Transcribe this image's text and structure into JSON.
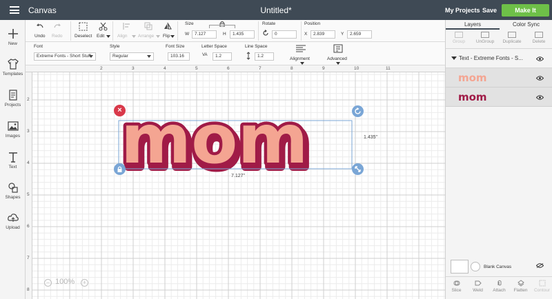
{
  "topbar": {
    "app_title": "Canvas",
    "doc_title": "Untitled*",
    "my_projects": "My Projects",
    "save": "Save",
    "make_it": "Make It"
  },
  "sidebar": {
    "items": [
      {
        "label": "New",
        "icon": "plus-icon"
      },
      {
        "label": "Templates",
        "icon": "shirt-icon"
      },
      {
        "label": "Projects",
        "icon": "projects-icon"
      },
      {
        "label": "Images",
        "icon": "image-icon"
      },
      {
        "label": "Text",
        "icon": "text-icon"
      },
      {
        "label": "Shapes",
        "icon": "shapes-icon"
      },
      {
        "label": "Upload",
        "icon": "cloud-upload-icon"
      }
    ]
  },
  "toolbar": {
    "undo": "Undo",
    "redo": "Redo",
    "deselect": "Deselect",
    "edit": "Edit",
    "align": "Align",
    "arrange": "Arrange",
    "flip": "Flip",
    "size_label": "Size",
    "w_label": "W",
    "w_value": "7.127",
    "h_label": "H",
    "h_value": "1.435",
    "rotate_label": "Rotate",
    "rotate_value": "0",
    "position_label": "Position",
    "x_label": "X",
    "x_value": "2.839",
    "y_label": "Y",
    "y_value": "2.659",
    "font_label": "Font",
    "font_value": "Extreme Fonts - Short Stuff",
    "style_label": "Style",
    "style_value": "Regular",
    "font_size_label": "Font Size",
    "font_size_value": "103.16",
    "letter_space_label": "Letter Space",
    "letter_space_value": "1.2",
    "line_space_label": "Line Space",
    "line_space_value": "1.2",
    "alignment_label": "Alignment",
    "advanced_label": "Advanced"
  },
  "canvas": {
    "ruler_top": [
      "2",
      "3",
      "4",
      "5",
      "6",
      "7",
      "8",
      "9",
      "10",
      "11"
    ],
    "ruler_left": [
      "2",
      "3",
      "4",
      "5",
      "6",
      "7",
      "8"
    ],
    "text_content": "mom",
    "width_label": "7.127\"",
    "height_label": "1.435\"",
    "zoom": "100%",
    "colors": {
      "fill": "#f4a592",
      "outline": "#a01b47",
      "selection": "#7aa6d6",
      "delete": "#d9394a",
      "handle": "#7aa6d6"
    }
  },
  "layers_panel": {
    "tabs": [
      "Layers",
      "Color Sync"
    ],
    "actions": [
      "Group",
      "UnGroup",
      "Duplicate",
      "Delete"
    ],
    "group_name": "Text - Extreme Fonts - S...",
    "layers": [
      {
        "name": "mom",
        "color": "#f4a592"
      },
      {
        "name": "mom",
        "color": "#a01b47"
      }
    ],
    "blank_canvas": "Blank Canvas",
    "bottom_actions": [
      "Slice",
      "Weld",
      "Attach",
      "Flatten",
      "Contour"
    ]
  }
}
